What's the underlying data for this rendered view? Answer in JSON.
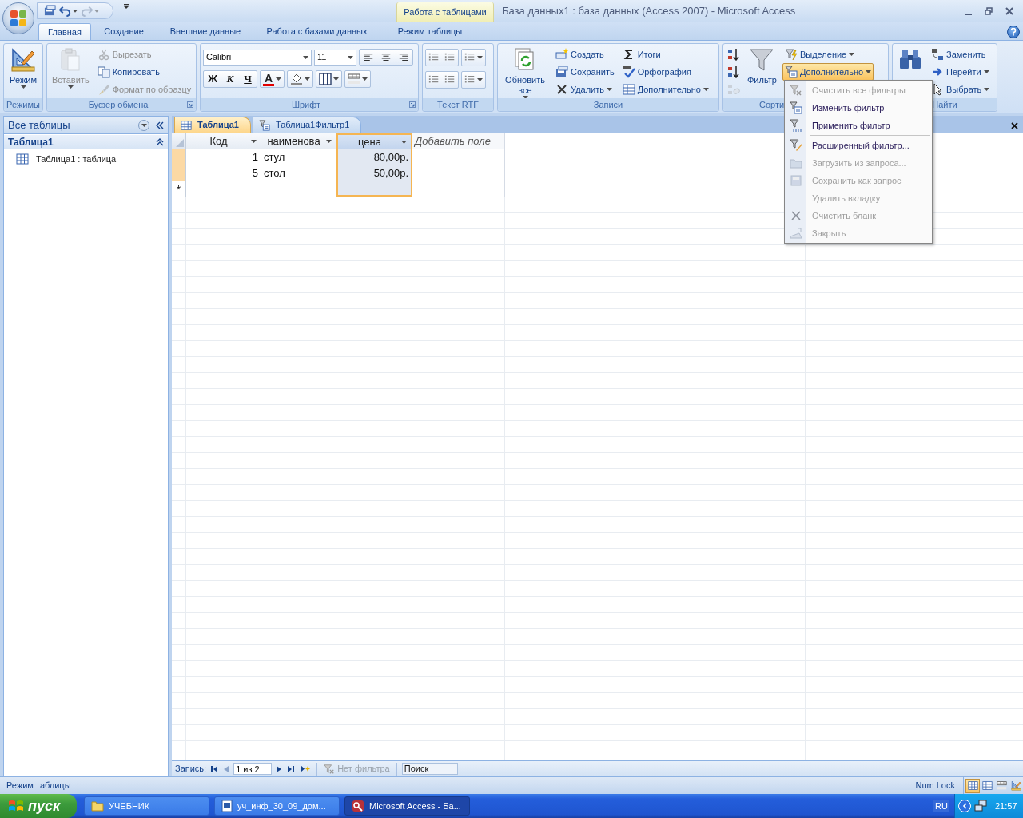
{
  "window": {
    "title": "База данных1 : база данных (Access 2007) - Microsoft Access",
    "context_tab": "Работа с таблицами"
  },
  "ribbon_tabs": [
    {
      "label": "Главная",
      "selected": true
    },
    {
      "label": "Создание",
      "selected": false
    },
    {
      "label": "Внешние данные",
      "selected": false
    },
    {
      "label": "Работа с базами данных",
      "selected": false
    },
    {
      "label": "Режим таблицы",
      "selected": false
    }
  ],
  "ribbon_groups": [
    {
      "label": "Режимы",
      "kind": "buttons",
      "launcher": false,
      "items": [
        {
          "kind": "large",
          "label": "Режим",
          "disabled": false,
          "dropdown": true,
          "pressed": false
        }
      ]
    },
    {
      "label": "Буфер обмена",
      "kind": "buttons",
      "launcher": true,
      "items": [
        {
          "kind": "large",
          "label": "Вставить",
          "disabled": true,
          "dropdown": true,
          "pressed": false
        },
        {
          "kind": "small",
          "label": "Вырезать",
          "disabled": true,
          "dropdown": false,
          "pressed": false
        },
        {
          "kind": "small",
          "label": "Копировать",
          "disabled": false,
          "dropdown": false,
          "pressed": false
        },
        {
          "kind": "small",
          "label": "Формат по образцу",
          "disabled": true,
          "dropdown": false,
          "pressed": false
        }
      ]
    },
    {
      "label": "Шрифт",
      "kind": "font",
      "launcher": true,
      "font": "Calibri",
      "size": "11",
      "styles": [
        "Ж",
        "К",
        "Ч"
      ],
      "color_letter": "A"
    },
    {
      "label": "Текст RTF",
      "kind": "rtf",
      "launcher": false
    },
    {
      "label": "Записи",
      "kind": "buttons",
      "launcher": false,
      "items": [
        {
          "kind": "large",
          "label": "Обновить все",
          "disabled": false,
          "dropdown": true,
          "pressed": false
        },
        {
          "kind": "small",
          "label": "Создать",
          "disabled": false,
          "dropdown": false,
          "pressed": false
        },
        {
          "kind": "small",
          "label": "Сохранить",
          "disabled": false,
          "dropdown": false,
          "pressed": false
        },
        {
          "kind": "small",
          "label": "Удалить",
          "disabled": false,
          "dropdown": true,
          "pressed": false
        },
        {
          "kind": "small",
          "label": "Итоги",
          "disabled": false,
          "dropdown": false,
          "pressed": false
        },
        {
          "kind": "small",
          "label": "Орфография",
          "disabled": false,
          "dropdown": false,
          "pressed": false
        },
        {
          "kind": "small",
          "label": "Дополнительно",
          "disabled": false,
          "dropdown": true,
          "pressed": false
        }
      ]
    },
    {
      "label": "Сорти",
      "kind": "buttons",
      "launcher": false,
      "items": [
        {
          "kind": "icon",
          "disabled": false
        },
        {
          "kind": "icon",
          "disabled": false
        },
        {
          "kind": "icon",
          "disabled": true
        },
        {
          "kind": "large",
          "label": "Фильтр",
          "disabled": false,
          "dropdown": false,
          "pressed": false
        },
        {
          "kind": "small",
          "label": "Выделение",
          "disabled": false,
          "dropdown": true,
          "pressed": false
        },
        {
          "kind": "small",
          "label": "Дополнительно",
          "disabled": false,
          "dropdown": true,
          "pressed": true
        }
      ]
    },
    {
      "label": "Найти",
      "kind": "buttons",
      "launcher": false,
      "items": [
        {
          "kind": "large",
          "disabled": false,
          "dropdown": false,
          "pressed": false
        },
        {
          "kind": "small",
          "label": "Заменить",
          "disabled": false,
          "dropdown": false,
          "pressed": false
        },
        {
          "kind": "small",
          "label": "Перейти",
          "disabled": false,
          "dropdown": true,
          "pressed": false
        },
        {
          "kind": "small",
          "label": "Выбрать",
          "disabled": false,
          "dropdown": true,
          "pressed": false
        }
      ]
    }
  ],
  "filter_menu": [
    {
      "kind": "item",
      "label": "Очистить все фильтры",
      "disabled": true
    },
    {
      "kind": "item",
      "label": "Изменить фильтр",
      "disabled": false
    },
    {
      "kind": "item",
      "label": "Применить фильтр",
      "disabled": false
    },
    {
      "kind": "separator"
    },
    {
      "kind": "item",
      "label": "Расширенный фильтр...",
      "disabled": false
    },
    {
      "kind": "item",
      "label": "Загрузить из запроса...",
      "disabled": true
    },
    {
      "kind": "item",
      "label": "Сохранить как запрос",
      "disabled": true
    },
    {
      "kind": "item",
      "label": "Удалить вкладку",
      "disabled": true
    },
    {
      "kind": "item",
      "label": "Очистить бланк",
      "disabled": true
    },
    {
      "kind": "item",
      "label": "Закрыть",
      "disabled": true
    }
  ],
  "navigation_pane": {
    "title": "Все таблицы",
    "groups": [
      {
        "label": "Таблица1",
        "expanded": true,
        "items": [
          "Таблица1 : таблица"
        ]
      }
    ]
  },
  "document_tabs": [
    {
      "label": "Таблица1",
      "selected": true
    },
    {
      "label": "Таблица1Фильтр1",
      "selected": false
    }
  ],
  "datasheet": {
    "columns": [
      {
        "label": "Код",
        "kind": "field",
        "selected": false
      },
      {
        "label": "наименова",
        "kind": "field",
        "selected": false
      },
      {
        "label": "цена",
        "kind": "field",
        "selected": true
      },
      {
        "label": "Добавить поле",
        "kind": "add",
        "selected": false
      }
    ],
    "rows": [
      [
        "1",
        "стул",
        "80,00р."
      ],
      [
        "5",
        "стол",
        "50,00р."
      ]
    ],
    "new_row_marker": "*"
  },
  "record_navigator": {
    "label": "Запись:",
    "position": "1 из 2",
    "filter": "Нет фильтра",
    "search_placeholder": "Поиск"
  },
  "status_bar": {
    "left": "Режим таблицы",
    "right": "Num Lock",
    "views": [
      {
        "selected": true
      },
      {
        "selected": false
      },
      {
        "selected": false
      },
      {
        "selected": false
      }
    ]
  },
  "taskbar": {
    "start": "пуск",
    "tasks": [
      {
        "label": "УЧЕБНИК",
        "selected": false
      },
      {
        "label": "уч_инф_30_09_дом...",
        "selected": false
      },
      {
        "label": "Microsoft Access - Ба...",
        "selected": true
      }
    ],
    "language": "RU",
    "clock": "21:57"
  }
}
